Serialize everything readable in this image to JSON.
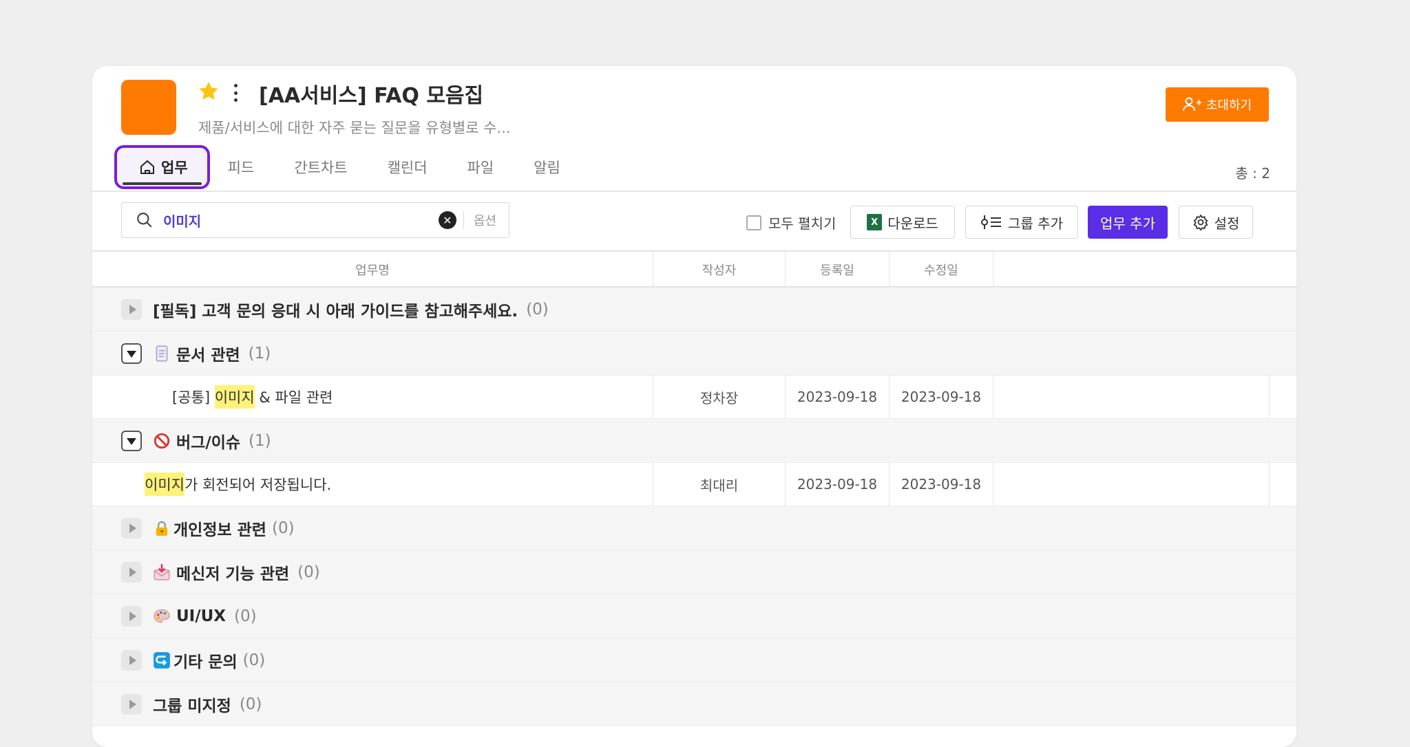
{
  "header": {
    "title": "[AA서비스] FAQ 모음집",
    "subtitle": "제품/서비스에 대한 자주 묻는 질문을 유형별로 수...",
    "invite_label": "초대하기",
    "brand_color": "#ff7a00"
  },
  "tabs": [
    {
      "label": "업무",
      "active": true
    },
    {
      "label": "피드"
    },
    {
      "label": "간트차트"
    },
    {
      "label": "캘린더"
    },
    {
      "label": "파일"
    },
    {
      "label": "알림"
    }
  ],
  "total_label": "총 : 2",
  "toolbar": {
    "search_value": "이미지",
    "options_label": "옵션",
    "expand_all_label": "모두 펼치기",
    "download_label": "다운로드",
    "add_group_label": "그룹 추가",
    "add_task_label": "업무 추가",
    "settings_label": "설정",
    "accent_color": "#5a2de6"
  },
  "columns": {
    "name": "업무명",
    "author": "작성자",
    "created": "등록일",
    "modified": "수정일"
  },
  "groups": [
    {
      "name": "[필독] 고객 문의 응대 시 아래 가이드를 참고해주세요.",
      "count": "(0)",
      "icon": "",
      "expanded": false
    },
    {
      "name": "문서 관련",
      "count": "(1)",
      "icon": "document-icon",
      "expanded": true,
      "task": {
        "prefix": "[공통] ",
        "highlight": "이미지",
        "suffix": " & 파일 관련",
        "author": "정차장",
        "created": "2023-09-18",
        "modified": "2023-09-18"
      }
    },
    {
      "name": "버그/이슈",
      "count": "(1)",
      "icon": "prohibited-icon",
      "expanded": true,
      "task": {
        "prefix": "",
        "highlight": "이미지",
        "suffix": "가 회전되어 저장됩니다.",
        "author": "최대리",
        "created": "2023-09-18",
        "modified": "2023-09-18"
      }
    },
    {
      "name": "개인정보 관련",
      "count": "(0)",
      "icon": "lock-icon",
      "expanded": false
    },
    {
      "name": "메신저 기능 관련",
      "count": "(0)",
      "icon": "inbox-download-icon",
      "expanded": false
    },
    {
      "name": "UI/UX",
      "count": "(0)",
      "icon": "palette-icon",
      "expanded": false
    },
    {
      "name": "기타 문의",
      "count": "(0)",
      "icon": "return-arrow-icon",
      "expanded": false
    },
    {
      "name": "그룹 미지정",
      "count": "(0)",
      "icon": "",
      "expanded": false
    }
  ]
}
